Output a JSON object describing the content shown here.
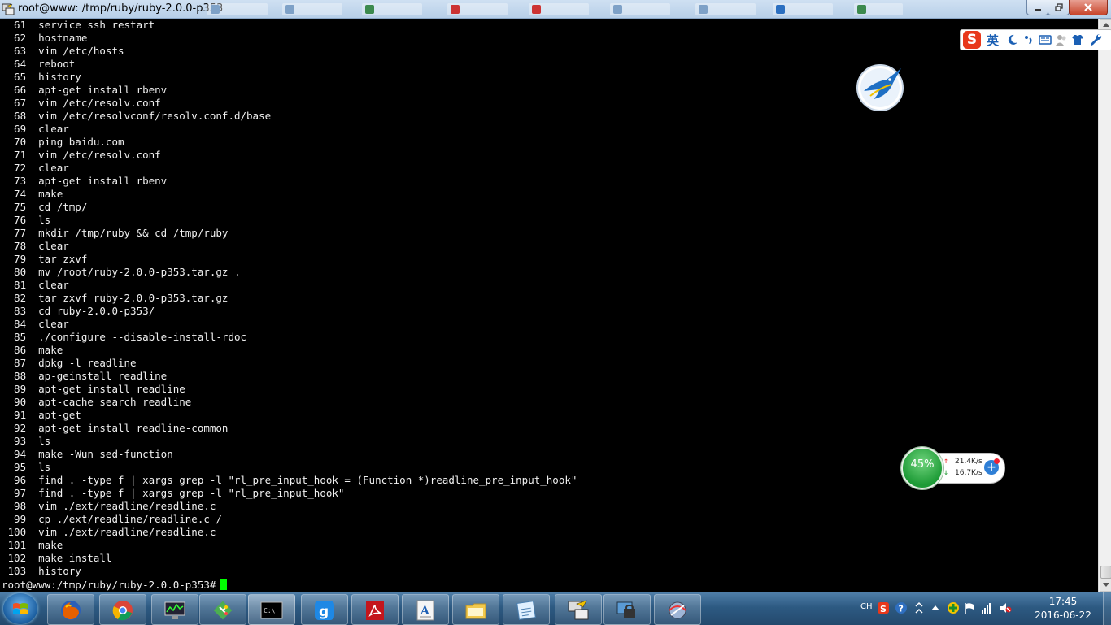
{
  "window": {
    "title": "root@www: /tmp/ruby/ruby-2.0.0-p353"
  },
  "terminal": {
    "history_lines": [
      "  61  service ssh restart",
      "  62  hostname",
      "  63  vim /etc/hosts",
      "  64  reboot",
      "  65  history",
      "  66  apt-get install rbenv",
      "  67  vim /etc/resolv.conf",
      "  68  vim /etc/resolvconf/resolv.conf.d/base",
      "  69  clear",
      "  70  ping baidu.com",
      "  71  vim /etc/resolv.conf",
      "  72  clear",
      "  73  apt-get install rbenv",
      "  74  make",
      "  75  cd /tmp/",
      "  76  ls",
      "  77  mkdir /tmp/ruby && cd /tmp/ruby",
      "  78  clear",
      "  79  tar zxvf",
      "  80  mv /root/ruby-2.0.0-p353.tar.gz .",
      "  81  clear",
      "  82  tar zxvf ruby-2.0.0-p353.tar.gz",
      "  83  cd ruby-2.0.0-p353/",
      "  84  clear",
      "  85  ./configure --disable-install-rdoc",
      "  86  make",
      "  87  dpkg -l readline",
      "  88  ap-geinstall readline",
      "  89  apt-get install readline",
      "  90  apt-cache search readline",
      "  91  apt-get",
      "  92  apt-get install readline-common",
      "  93  ls",
      "  94  make -Wun sed-function",
      "  95  ls",
      "  96  find . -type f | xargs grep -l \"rl_pre_input_hook = (Function *)readline_pre_input_hook\"",
      "  97  find . -type f | xargs grep -l \"rl_pre_input_hook\"",
      "  98  vim ./ext/readline/readline.c",
      "  99  cp ./ext/readline/readline.c /",
      " 100  vim ./ext/readline/readline.c",
      " 101  make",
      " 102  make install",
      " 103  history"
    ],
    "prompt": "root@www:/tmp/ruby/ruby-2.0.0-p353#",
    "cursor_color": "#00ff00"
  },
  "ime": {
    "logo": "S",
    "mode": "英"
  },
  "netmon": {
    "cpu_percent": "45%",
    "upload": "21.4K/s",
    "download": "16.7K/s"
  },
  "taskbar": {
    "apps": [
      "firefox-icon",
      "chrome-icon",
      "system-monitor-icon",
      "git-icon",
      "cmd-icon",
      "app-g-icon",
      "pdf-reader-icon",
      "text-editor-icon",
      "file-explorer-icon",
      "notepad-icon",
      "putty-icon",
      "remote-desktop-icon",
      "network-tool-icon"
    ],
    "tray_lang": "CH",
    "clock_time": "17:45",
    "clock_date": "2016-06-22"
  },
  "colors": {
    "terminal_bg": "#000000",
    "terminal_fg": "#f0f0f0",
    "taskbar": "#2d5a82"
  }
}
